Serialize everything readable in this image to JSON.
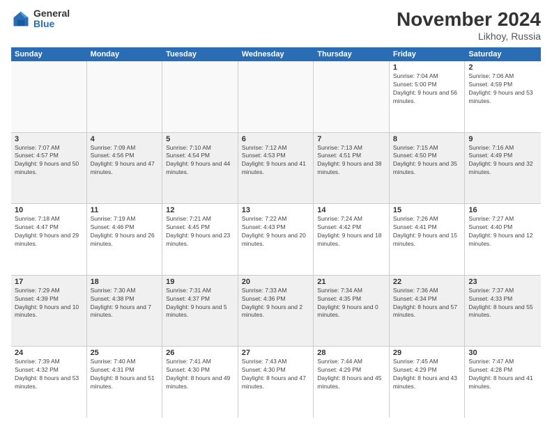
{
  "logo": {
    "general": "General",
    "blue": "Blue"
  },
  "title": "November 2024",
  "location": "Likhoy, Russia",
  "days_header": [
    "Sunday",
    "Monday",
    "Tuesday",
    "Wednesday",
    "Thursday",
    "Friday",
    "Saturday"
  ],
  "weeks": [
    [
      {
        "day": "",
        "info": ""
      },
      {
        "day": "",
        "info": ""
      },
      {
        "day": "",
        "info": ""
      },
      {
        "day": "",
        "info": ""
      },
      {
        "day": "",
        "info": ""
      },
      {
        "day": "1",
        "info": "Sunrise: 7:04 AM\nSunset: 5:00 PM\nDaylight: 9 hours and 56 minutes."
      },
      {
        "day": "2",
        "info": "Sunrise: 7:06 AM\nSunset: 4:59 PM\nDaylight: 9 hours and 53 minutes."
      }
    ],
    [
      {
        "day": "3",
        "info": "Sunrise: 7:07 AM\nSunset: 4:57 PM\nDaylight: 9 hours and 50 minutes."
      },
      {
        "day": "4",
        "info": "Sunrise: 7:09 AM\nSunset: 4:56 PM\nDaylight: 9 hours and 47 minutes."
      },
      {
        "day": "5",
        "info": "Sunrise: 7:10 AM\nSunset: 4:54 PM\nDaylight: 9 hours and 44 minutes."
      },
      {
        "day": "6",
        "info": "Sunrise: 7:12 AM\nSunset: 4:53 PM\nDaylight: 9 hours and 41 minutes."
      },
      {
        "day": "7",
        "info": "Sunrise: 7:13 AM\nSunset: 4:51 PM\nDaylight: 9 hours and 38 minutes."
      },
      {
        "day": "8",
        "info": "Sunrise: 7:15 AM\nSunset: 4:50 PM\nDaylight: 9 hours and 35 minutes."
      },
      {
        "day": "9",
        "info": "Sunrise: 7:16 AM\nSunset: 4:49 PM\nDaylight: 9 hours and 32 minutes."
      }
    ],
    [
      {
        "day": "10",
        "info": "Sunrise: 7:18 AM\nSunset: 4:47 PM\nDaylight: 9 hours and 29 minutes."
      },
      {
        "day": "11",
        "info": "Sunrise: 7:19 AM\nSunset: 4:46 PM\nDaylight: 9 hours and 26 minutes."
      },
      {
        "day": "12",
        "info": "Sunrise: 7:21 AM\nSunset: 4:45 PM\nDaylight: 9 hours and 23 minutes."
      },
      {
        "day": "13",
        "info": "Sunrise: 7:22 AM\nSunset: 4:43 PM\nDaylight: 9 hours and 20 minutes."
      },
      {
        "day": "14",
        "info": "Sunrise: 7:24 AM\nSunset: 4:42 PM\nDaylight: 9 hours and 18 minutes."
      },
      {
        "day": "15",
        "info": "Sunrise: 7:26 AM\nSunset: 4:41 PM\nDaylight: 9 hours and 15 minutes."
      },
      {
        "day": "16",
        "info": "Sunrise: 7:27 AM\nSunset: 4:40 PM\nDaylight: 9 hours and 12 minutes."
      }
    ],
    [
      {
        "day": "17",
        "info": "Sunrise: 7:29 AM\nSunset: 4:39 PM\nDaylight: 9 hours and 10 minutes."
      },
      {
        "day": "18",
        "info": "Sunrise: 7:30 AM\nSunset: 4:38 PM\nDaylight: 9 hours and 7 minutes."
      },
      {
        "day": "19",
        "info": "Sunrise: 7:31 AM\nSunset: 4:37 PM\nDaylight: 9 hours and 5 minutes."
      },
      {
        "day": "20",
        "info": "Sunrise: 7:33 AM\nSunset: 4:36 PM\nDaylight: 9 hours and 2 minutes."
      },
      {
        "day": "21",
        "info": "Sunrise: 7:34 AM\nSunset: 4:35 PM\nDaylight: 9 hours and 0 minutes."
      },
      {
        "day": "22",
        "info": "Sunrise: 7:36 AM\nSunset: 4:34 PM\nDaylight: 8 hours and 57 minutes."
      },
      {
        "day": "23",
        "info": "Sunrise: 7:37 AM\nSunset: 4:33 PM\nDaylight: 8 hours and 55 minutes."
      }
    ],
    [
      {
        "day": "24",
        "info": "Sunrise: 7:39 AM\nSunset: 4:32 PM\nDaylight: 8 hours and 53 minutes."
      },
      {
        "day": "25",
        "info": "Sunrise: 7:40 AM\nSunset: 4:31 PM\nDaylight: 8 hours and 51 minutes."
      },
      {
        "day": "26",
        "info": "Sunrise: 7:41 AM\nSunset: 4:30 PM\nDaylight: 8 hours and 49 minutes."
      },
      {
        "day": "27",
        "info": "Sunrise: 7:43 AM\nSunset: 4:30 PM\nDaylight: 8 hours and 47 minutes."
      },
      {
        "day": "28",
        "info": "Sunrise: 7:44 AM\nSunset: 4:29 PM\nDaylight: 8 hours and 45 minutes."
      },
      {
        "day": "29",
        "info": "Sunrise: 7:45 AM\nSunset: 4:29 PM\nDaylight: 8 hours and 43 minutes."
      },
      {
        "day": "30",
        "info": "Sunrise: 7:47 AM\nSunset: 4:28 PM\nDaylight: 8 hours and 41 minutes."
      }
    ]
  ]
}
